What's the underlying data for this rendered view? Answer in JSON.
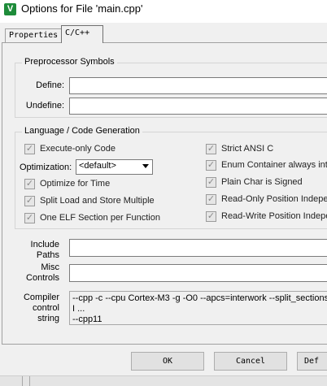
{
  "window": {
    "icon_letter": "V",
    "title": "Options for File 'main.cpp'"
  },
  "tabs": [
    {
      "label": "Properties",
      "active": false
    },
    {
      "label": "C/C++",
      "active": true
    }
  ],
  "preprocessor": {
    "group_title": "Preprocessor Symbols",
    "define_label": "Define:",
    "define_value": "",
    "undefine_label": "Undefine:",
    "undefine_value": ""
  },
  "language": {
    "group_title": "Language / Code Generation",
    "execute_only": {
      "label": "Execute-only Code",
      "checked": true
    },
    "optimization_label": "Optimization:",
    "optimization_value": "<default>",
    "optimize_time": {
      "label": "Optimize for Time",
      "checked": true
    },
    "split_load": {
      "label": "Split Load and Store Multiple",
      "checked": true
    },
    "one_elf": {
      "label": "One ELF Section per Function",
      "checked": true
    },
    "strict_ansi": {
      "label": "Strict ANSI C",
      "checked": true
    },
    "enum_container": {
      "label": "Enum Container always int",
      "checked": true
    },
    "plain_char": {
      "label": "Plain Char is Signed",
      "checked": true
    },
    "ro_position": {
      "label": "Read-Only Position Indepen",
      "checked": true
    },
    "rw_position": {
      "label": "Read-Write Position Indepen",
      "checked": true
    }
  },
  "paths": {
    "include_label_1": "Include",
    "include_label_2": "Paths",
    "include_value": "",
    "misc_label_1": "Misc",
    "misc_label_2": "Controls",
    "misc_value": "",
    "compiler_label_1": "Compiler",
    "compiler_label_2": "control",
    "compiler_label_3": "string",
    "compiler_value": "--cpp -c --cpu Cortex-M3 -g -O0 --apcs=interwork --split_sections -I ...\n--cpp11"
  },
  "buttons": {
    "ok": "OK",
    "cancel": "Cancel",
    "defaults": "Def"
  },
  "colors": {
    "dialog_bg": "#f0f0f0",
    "app_icon": "#1e8c3a"
  }
}
